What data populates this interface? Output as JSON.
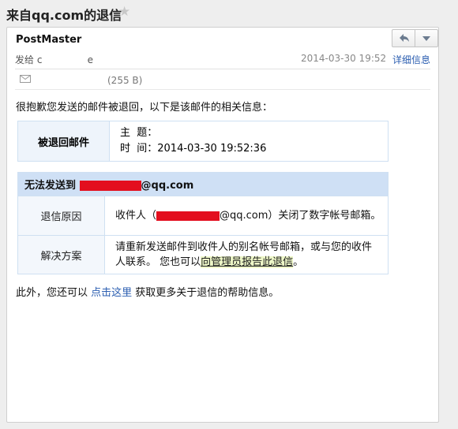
{
  "window": {
    "title": "来自qq.com的退信"
  },
  "message": {
    "sender": "PostMaster",
    "to_label": "发给",
    "to_partial": "c               e",
    "date": "2014-03-30 19:52",
    "detail_link": "详细信息"
  },
  "attachment": {
    "size": "(255 B)"
  },
  "body": {
    "intro": "很抱歉您发送的邮件被退回，以下是该邮件的相关信息：",
    "bounced": {
      "label": "被退回邮件",
      "subject_label": "主  题：",
      "subject_value": "",
      "time_label": "时  间：",
      "time_value": "2014-03-30 19:52:36"
    },
    "failure": {
      "head_prefix": "无法发送到 ",
      "head_suffix": "@qq.com",
      "reason_label": "退信原因",
      "reason_text_pre": "收件人（",
      "reason_text_post": "@qq.com）关闭了数字帐号邮箱。",
      "solution_label": "解决方案",
      "solution_text": "请重新发送邮件到收件人的别名帐号邮箱，或与您的收件人联系。 您也可以",
      "solution_link": "向管理员报告此退信",
      "solution_end": "。"
    },
    "footer_pre": "此外，您还可以 ",
    "footer_link": "点击这里",
    "footer_post": " 获取更多关于退信的帮助信息。"
  },
  "colors": {
    "redaction": "#e30e1e",
    "link": "#2a5db0",
    "table_header": "#cfe0f5"
  }
}
